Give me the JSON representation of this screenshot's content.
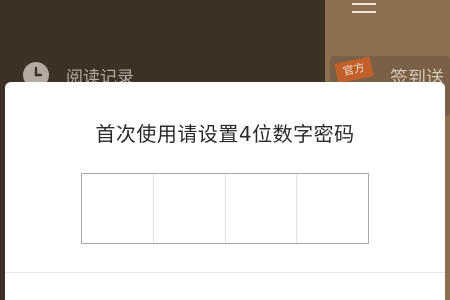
{
  "background": {
    "history_label": "阅读记录",
    "badge_label": "官方",
    "card_text": "签到送"
  },
  "dialog": {
    "title": "首次使用请设置4位数字密码",
    "pin_digits": [
      "",
      "",
      "",
      ""
    ]
  },
  "colors": {
    "overlay_left": "#3d3126",
    "overlay_right": "#8c7050",
    "dialog_bg": "#ffffff",
    "pin_border": "#a8a8a8"
  }
}
